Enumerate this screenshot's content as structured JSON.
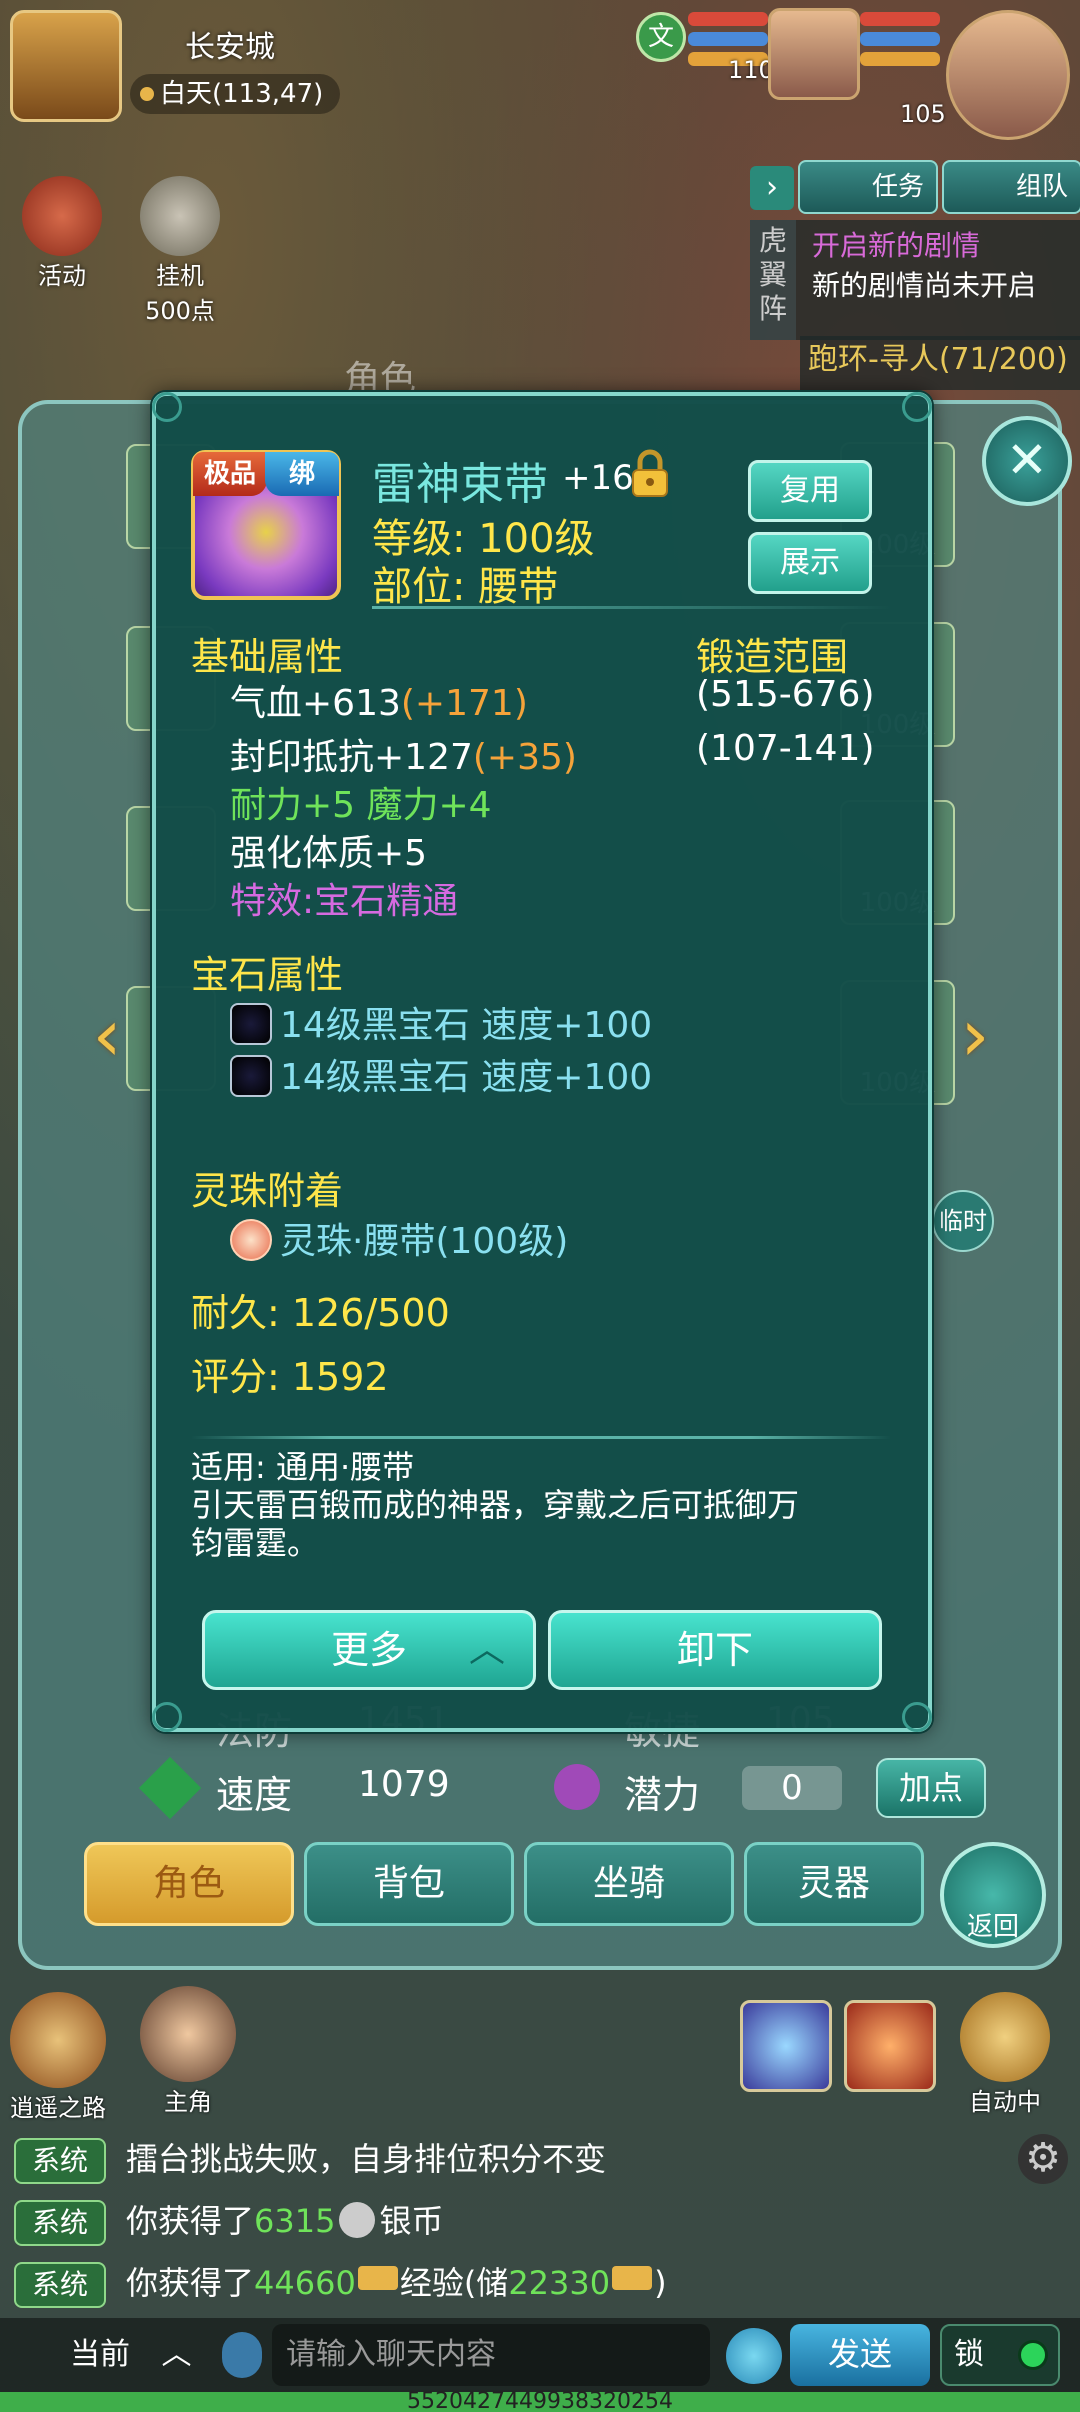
{
  "top": {
    "location": "长安城",
    "coords": "白天(113,47)",
    "player_level": "110",
    "pet_level": "105"
  },
  "side_buttons": {
    "activity": "活动",
    "auto_hang": "挂机",
    "points": "500点"
  },
  "quest": {
    "tab_task": "任务",
    "tab_team": "组队",
    "side_label": "虎翼阵",
    "title": "开启新的剧情",
    "desc": "新的剧情尚未开启",
    "loop": "跑环-寻人(71/200)"
  },
  "role_window": {
    "title": "角色",
    "slot_level": "100级",
    "temp_label": "临时",
    "stats": {
      "magic_def_label": "法防",
      "magic_def_value": "1451",
      "agility_label": "敏捷",
      "agility_value": "105",
      "speed_label": "速度",
      "speed_value": "1079",
      "potential_label": "潜力",
      "potential_value": "0",
      "add_point": "加点"
    },
    "tabs": [
      "角色",
      "背包",
      "坐骑",
      "灵器"
    ],
    "return_label": "返回"
  },
  "item": {
    "grade": "极品",
    "bind": "绑",
    "name": "雷神束带",
    "plus": "+16",
    "level": "等级: 100级",
    "slot": "部位: 腰带",
    "btn_reuse": "复用",
    "btn_show": "展示",
    "base_title": "基础属性",
    "forge_title": "锻造范围",
    "attr_hp": "气血+613",
    "attr_hp_bonus": "(+171)",
    "range_hp": "(515-676)",
    "attr_seal": "封印抵抗+127",
    "attr_seal_bonus": "(+35)",
    "range_seal": "(107-141)",
    "attr_green": "耐力+5 魔力+4",
    "attr_enhance": "强化体质+5",
    "attr_effect": "特效:宝石精通",
    "gem_title": "宝石属性",
    "gems": [
      "14级黑宝石 速度+100",
      "14级黑宝石 速度+100"
    ],
    "pearl_title": "灵珠附着",
    "pearl": "灵珠·腰带(100级)",
    "durability": "耐久: 126/500",
    "score": "评分: 1592",
    "usage": "适用: 通用·腰带",
    "desc_line1": "引天雷百锻而成的神器，穿戴之后可抵御万",
    "desc_line2": "钧雷霆。",
    "btn_more": "更多",
    "btn_unequip": "卸下"
  },
  "hud": {
    "journey": "逍遥之路",
    "hero": "主角",
    "auto": "自动中"
  },
  "chat": {
    "tag": "系统",
    "line1": "擂台挑战失败，自身排位积分不变",
    "line2_prefix": "你获得了",
    "line2_num": "6315",
    "line2_suffix": "银币",
    "line3_prefix": "你获得了",
    "line3_num": "44660",
    "line3_mid": "经验(储",
    "line3_num2": "22330",
    "line3_suffix": ")",
    "channel": "当前",
    "placeholder": "请输入聊天内容",
    "send": "发送",
    "lock": "锁"
  },
  "footer": "552042744993832025­4"
}
